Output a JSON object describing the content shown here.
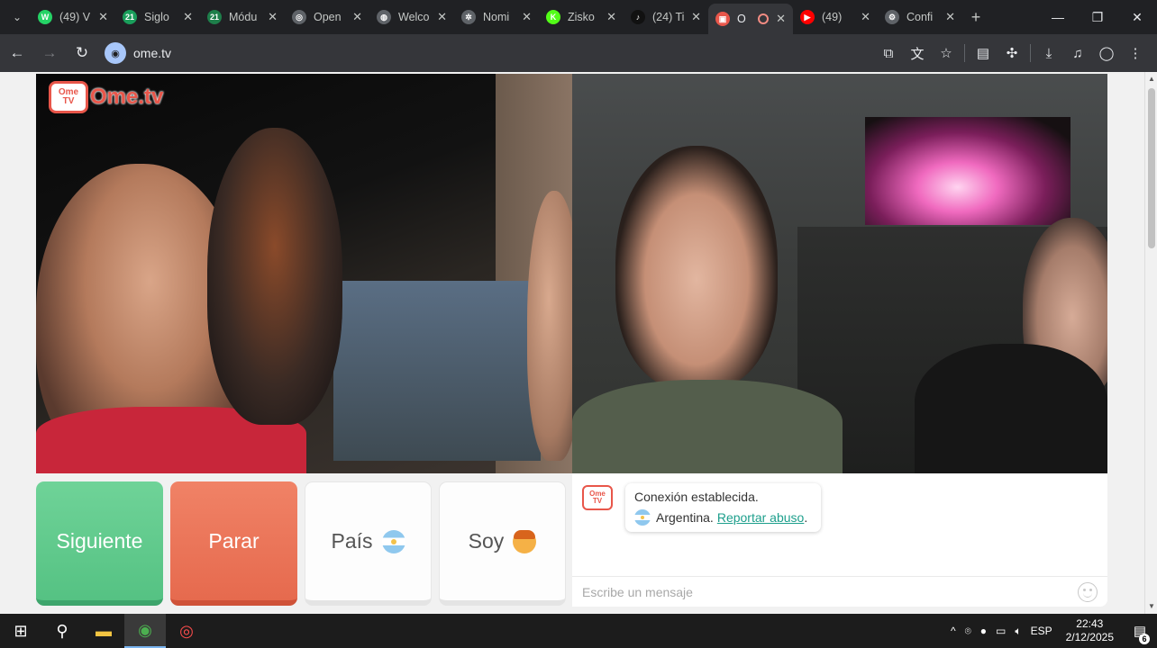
{
  "browser": {
    "tabs": [
      {
        "title": "(49) V",
        "favicon": "whatsapp-icon",
        "color": "#25d366",
        "glyph": "W"
      },
      {
        "title": "Siglo",
        "favicon": "siglo21-icon",
        "color": "#1a9e5b",
        "glyph": "21"
      },
      {
        "title": "Módu",
        "favicon": "classroom-icon",
        "color": "#1e7e4a",
        "glyph": "21"
      },
      {
        "title": "Open",
        "favicon": "openai-icon",
        "color": "#5f6368",
        "glyph": "◎"
      },
      {
        "title": "Welco",
        "favicon": "globe-icon",
        "color": "#5f6368",
        "glyph": "◍"
      },
      {
        "title": "Nomi",
        "favicon": "chatgpt-icon",
        "color": "#5f6368",
        "glyph": "✲"
      },
      {
        "title": "Zisko",
        "favicon": "kick-icon",
        "color": "#53fc18",
        "glyph": "K"
      },
      {
        "title": "(24) Ti",
        "favicon": "tiktok-icon",
        "color": "#111111",
        "glyph": "♪"
      },
      {
        "title": "O",
        "favicon": "ometv-icon",
        "color": "#e8564a",
        "glyph": "▣",
        "active": true,
        "recording": true
      },
      {
        "title": "(49)",
        "favicon": "youtube-icon",
        "color": "#ff0000",
        "glyph": "▶"
      },
      {
        "title": "Confi",
        "favicon": "settings-icon",
        "color": "#5f6368",
        "glyph": "⚙"
      }
    ],
    "url": "ome.tv"
  },
  "page": {
    "logo_box_line1": "Ome",
    "logo_box_line2": "TV",
    "logo_text": "Ome.tv",
    "buttons": {
      "next": "Siguiente",
      "stop": "Parar",
      "country": "País",
      "me": "Soy"
    },
    "chat": {
      "status": "Conexión establecida.",
      "country": "Argentina.",
      "report_link": "Reportar abuso",
      "report_after": ".",
      "input_placeholder": "Escribe un mensaje"
    }
  },
  "taskbar": {
    "language": "ESP",
    "time": "22:43",
    "date": "2/12/2025",
    "notifications": "6"
  },
  "colors": {
    "next": "#5fcb8c",
    "stop": "#ea7358",
    "brand": "#e8564a",
    "link": "#1d9f8c"
  }
}
